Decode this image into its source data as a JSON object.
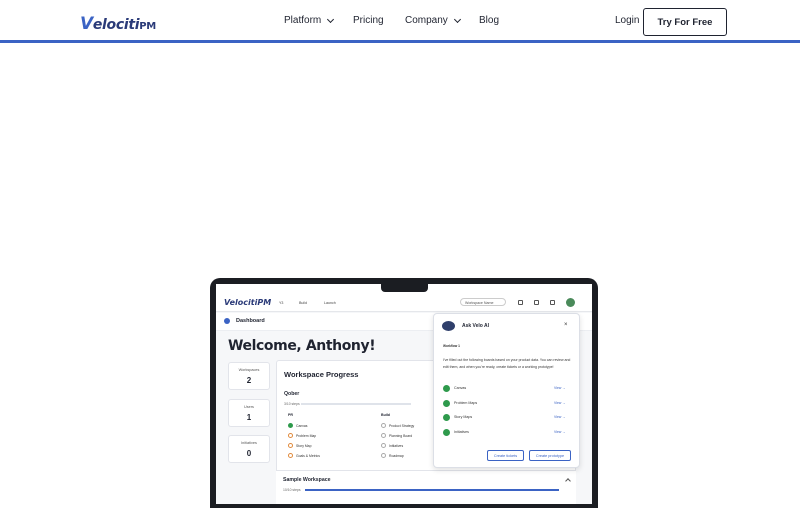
{
  "brand": {
    "logo_main": "Velociti",
    "logo_suffix": "PM",
    "accent": "#3b63c4"
  },
  "nav": {
    "items": [
      {
        "label": "Platform",
        "has_menu": true
      },
      {
        "label": "Pricing",
        "has_menu": false
      },
      {
        "label": "Company",
        "has_menu": true
      },
      {
        "label": "Blog",
        "has_menu": false
      }
    ],
    "login": "Login",
    "cta": "Try For Free"
  },
  "app": {
    "logo": "VelocitiPM",
    "crumbs": [
      "Y3",
      "Build",
      "Launch"
    ],
    "workspace_select": "Workspace Name",
    "section": "Dashboard",
    "welcome": "Welcome, Anthony!",
    "stats": [
      {
        "label": "Workspaces",
        "value": "2"
      },
      {
        "label": "Users",
        "value": "1"
      },
      {
        "label": "Initiatives",
        "value": "0"
      }
    ],
    "progress": {
      "title": "Workspace Progress",
      "workspace": "Qober",
      "steps": "3/10 steps",
      "columns": [
        {
          "title": "PR",
          "tasks": [
            {
              "label": "Canvas",
              "state": "done"
            },
            {
              "label": "Problem Map",
              "state": "pending"
            },
            {
              "label": "Story Map",
              "state": "pending"
            },
            {
              "label": "Goals & Metrics",
              "state": "pending"
            }
          ]
        },
        {
          "title": "Build",
          "tasks": [
            {
              "label": "Product Strategy",
              "state": "todo"
            },
            {
              "label": "Planning Board",
              "state": "todo"
            },
            {
              "label": "Initiatives",
              "state": "todo"
            },
            {
              "label": "Roadmap",
              "state": "todo"
            }
          ]
        }
      ],
      "second_workspace": "Sample Workspace",
      "second_steps": "10/10 steps"
    },
    "ai": {
      "title": "Ask Velo AI",
      "close": "×",
      "workflow": "Workflow 1",
      "message": "I've filled out the following boards based on your product data. You can review and edit them, and when you're ready, create tickets or a working prototype!",
      "items": [
        "Canvas",
        "Problem Maps",
        "Story Maps",
        "Initiatives"
      ],
      "view_label": "View →",
      "btn_tickets": "Create tickets",
      "btn_prototype": "Create prototype"
    }
  }
}
